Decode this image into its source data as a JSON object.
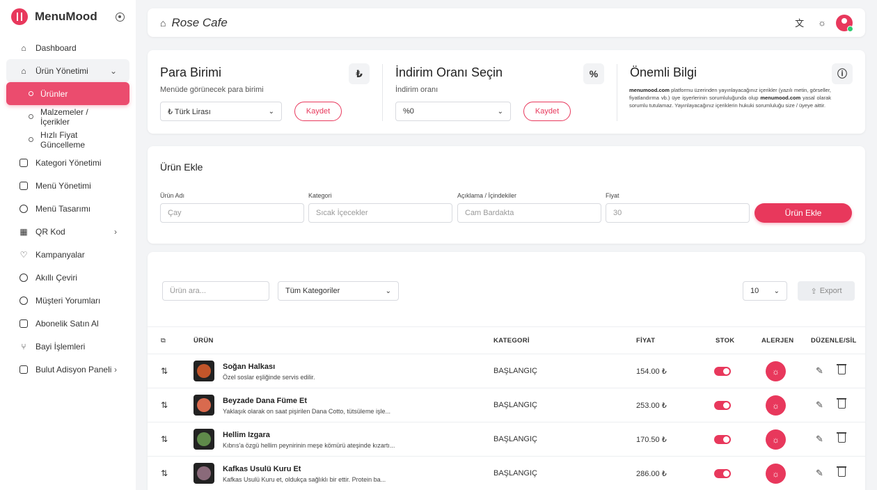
{
  "app": {
    "name": "MenuMood"
  },
  "sidebar": {
    "items": [
      {
        "label": "Dashboard"
      },
      {
        "label": "Ürün Yönetimi"
      },
      {
        "label": "Ürünler"
      },
      {
        "label": "Malzemeler / İçerikler"
      },
      {
        "label": "Hızlı Fiyat Güncelleme"
      },
      {
        "label": "Kategori Yönetimi"
      },
      {
        "label": "Menü Yönetimi"
      },
      {
        "label": "Menü Tasarımı"
      },
      {
        "label": "QR Kod"
      },
      {
        "label": "Kampanyalar"
      },
      {
        "label": "Akıllı Çeviri"
      },
      {
        "label": "Müşteri Yorumları"
      },
      {
        "label": "Abonelik Satın Al"
      },
      {
        "label": "Bayi İşlemleri"
      },
      {
        "label": "Bulut Adisyon Paneli"
      }
    ]
  },
  "header": {
    "title": "Rose Cafe"
  },
  "currency": {
    "title": "Para Birimi",
    "subtitle": "Menüde görünecek para birimi",
    "value": "₺ Türk Lirası",
    "save": "Kaydet"
  },
  "discount": {
    "title": "İndirim Oranı Seçin",
    "subtitle": "İndirim oranı",
    "value": "%0",
    "save": "Kaydet"
  },
  "info": {
    "title": "Önemli Bilgi",
    "brand1": "menumood.com",
    "text1": " platformu üzerinden yayınlayacağınız içerikler (yazılı metin, görseller, fiyatlandırma vb.) üye işyerlerinin sorumluluğunda olup ",
    "brand2": "menumood.com",
    "text2": " yasal olarak sorumlu tutulamaz. Yayınlayacağınız içeriklerin hukuki sorumluluğu size / üyeye aittir."
  },
  "add_product": {
    "title": "Ürün Ekle",
    "name_label": "Ürün Adı",
    "name_placeholder": "Çay",
    "category_label": "Kategori",
    "category_placeholder": "Sıcak İçecekler",
    "desc_label": "Açıklama / İçindekiler",
    "desc_placeholder": "Cam Bardakta",
    "price_label": "Fiyat",
    "price_placeholder": "30",
    "submit": "Ürün Ekle"
  },
  "list": {
    "search_placeholder": "Ürün ara...",
    "category_filter": "Tüm Kategoriler",
    "page_size": "10",
    "export": "Export",
    "columns": {
      "product": "ÜRÜN",
      "category": "KATEGORİ",
      "price": "FİYAT",
      "stock": "STOK",
      "allergen": "ALERJEN",
      "edit": "DÜZENLE/SİL"
    },
    "rows": [
      {
        "name": "Soğan Halkası",
        "desc": "Özel soslar eşliğinde servis edilir.",
        "category": "BAŞLANGIÇ",
        "price": "154.00 ₺",
        "thumb_color": "#c2552a"
      },
      {
        "name": "Beyzade Dana Füme Et",
        "desc": "Yaklaşık olarak on saat pişirilen Dana Cotto, tütsüleme işle...",
        "category": "BAŞLANGIÇ",
        "price": "253.00 ₺",
        "thumb_color": "#d96a4e"
      },
      {
        "name": "Hellim Izgara",
        "desc": "Kıbrıs'a özgü hellim peynirinin meşe kömürü ateşinde kızartı...",
        "category": "BAŞLANGIÇ",
        "price": "170.50 ₺",
        "thumb_color": "#5f8a4a"
      },
      {
        "name": "Kafkas Usulü Kuru Et",
        "desc": "Kafkas Usulü Kuru et, oldukça sağlıklı bir ettir. Protein ba...",
        "category": "BAŞLANGIÇ",
        "price": "286.00 ₺",
        "thumb_color": "#8a6a7a"
      }
    ]
  },
  "colors": {
    "accent": "#e8385c",
    "background": "#f3f4f6"
  }
}
